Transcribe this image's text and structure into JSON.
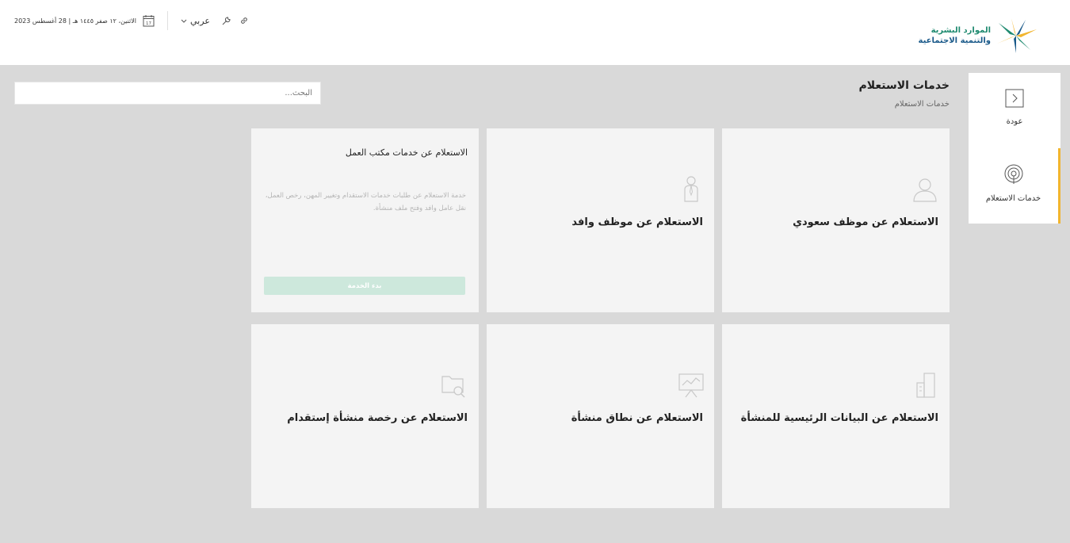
{
  "header": {
    "logo_line1": "الموارد البشرية",
    "logo_line2": "والتنمية الاجتماعية",
    "date": "الاثنين، ١٢ صفر ١٤٤٥ هـ | 28 أغسطس 2023",
    "calendar_day": "17",
    "language": "عربي"
  },
  "sidebar": {
    "back_label": "عودة",
    "services_label": "خدمات الاستعلام"
  },
  "main": {
    "title": "خدمات الاستعلام",
    "breadcrumb": "خدمات الاستعلام",
    "search_placeholder": "البحث..."
  },
  "cards": {
    "saudi_employee": "الاستعلام عن موظف سعودي",
    "expat_employee": "الاستعلام عن موظف وافد",
    "labor_office": {
      "title": "الاستعلام عن خدمات مكتب العمل",
      "description": "خدمة الاستعلام عن طلبات خدمات الاستقدام وتغيير المهن، رخص العمل، نقل عامل وافد وفتح ملف منشأة.",
      "button": "بدء الخدمة"
    },
    "establishment_data": "الاستعلام عن البيانات الرئيسية للمنشأة",
    "establishment_range": "الاستعلام عن نطاق منشأة",
    "recruitment_license": "الاستعلام عن رخصة منشأة إستقدام"
  },
  "colors": {
    "accent": "#f2b52e",
    "button": "#cde8dc",
    "card_bg": "#f4f4f4",
    "page_bg": "#d9d9d9"
  }
}
